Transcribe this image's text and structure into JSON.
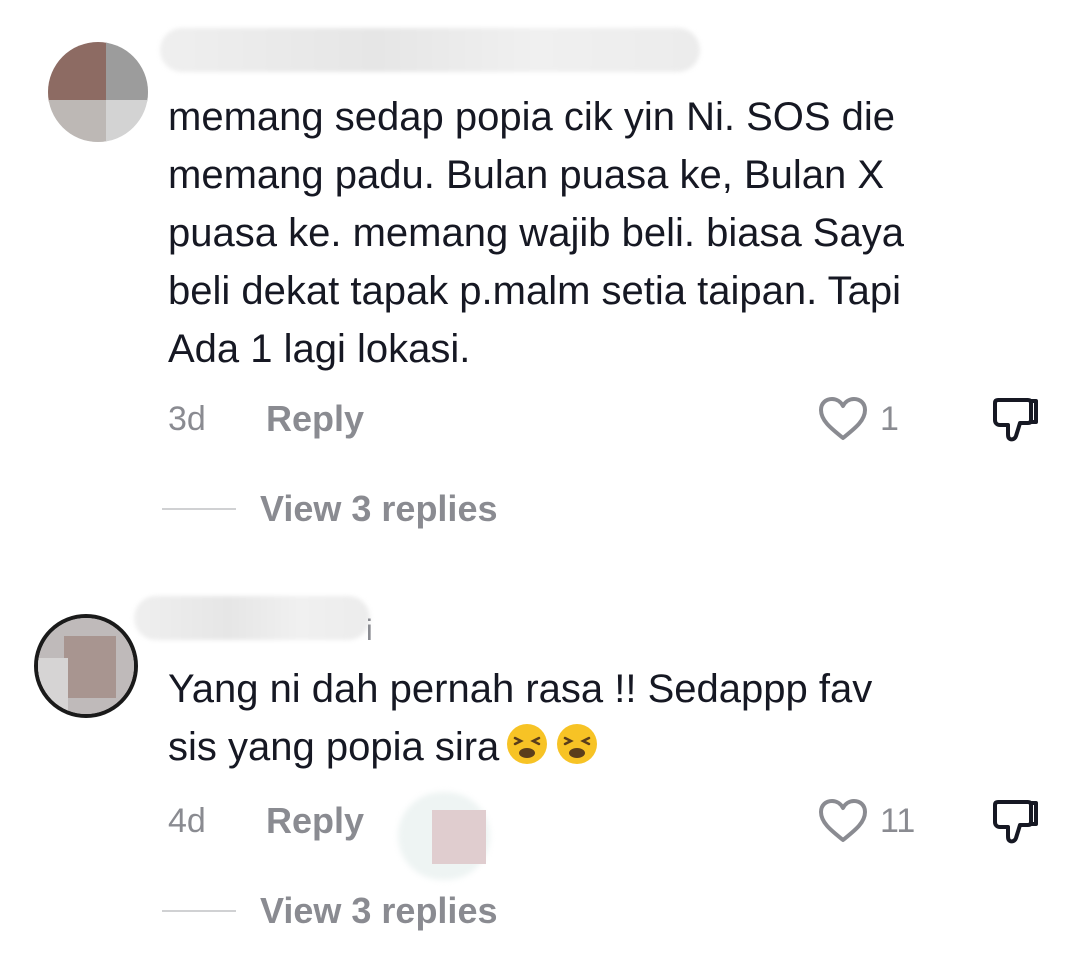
{
  "comments": [
    {
      "username_tail": "",
      "text": "memang sedap popia cik yin Ni. SOS die\nmemang padu. Bulan puasa ke, Bulan X\npuasa ke. memang wajib beli. biasa Saya\nbeli dekat tapak p.malm setia taipan. Tapi\nAda 1 lagi lokasi.",
      "time": "3d",
      "reply_label": "Reply",
      "likes": "1",
      "view_replies": "View 3 replies"
    },
    {
      "username_tail": "i",
      "text": "Yang ni dah pernah rasa !! Sedappp fav\nsis yang popia sira",
      "emojis": [
        "tired-face-emoji",
        "tired-face-emoji"
      ],
      "time": "4d",
      "reply_label": "Reply",
      "likes": "11",
      "view_replies": "View 3 replies"
    }
  ],
  "icons": {
    "like": "heart-outline-icon",
    "dislike": "thumbs-down-outline-icon"
  },
  "colors": {
    "text": "#161823",
    "secondary": "#8a8b91",
    "divider": "#d0d1d3",
    "emoji_face": "#f7c325"
  }
}
